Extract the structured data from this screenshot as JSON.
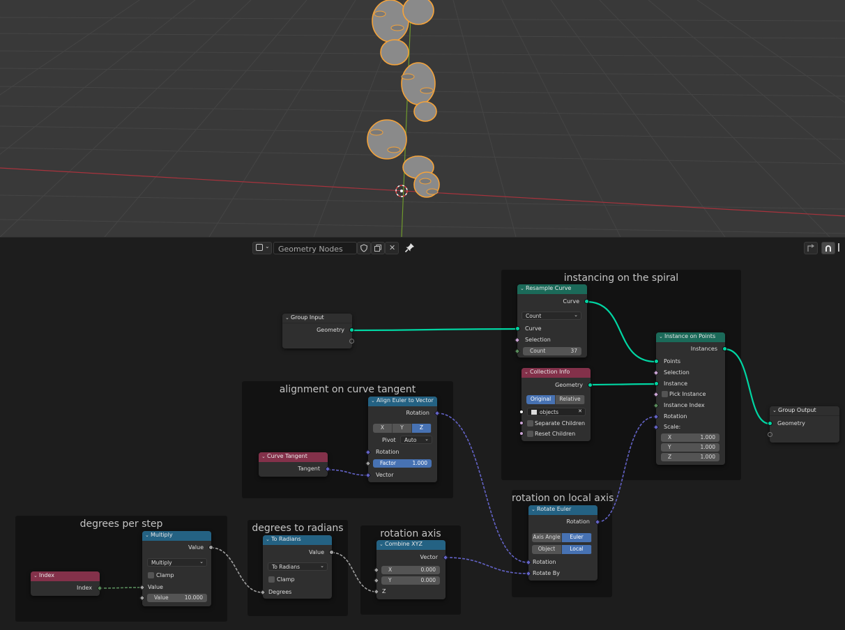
{
  "header": {
    "node_tree_name": "Geometry Nodes"
  },
  "frames": {
    "instancing": "instancing on the spiral",
    "alignment": "alignment on curve tangent",
    "degrees_per_step": "degrees per step",
    "degrees_to_radians": "degrees to radians",
    "rotation_axis": "rotation axis",
    "rotation_local": "rotation on local axis"
  },
  "nodes": {
    "group_input": {
      "title": "Group Input",
      "geometry": "Geometry"
    },
    "resample_curve": {
      "title": "Resample Curve",
      "out_curve": "Curve",
      "mode": "Count",
      "in_curve": "Curve",
      "selection": "Selection",
      "count_label": "Count",
      "count_value": "37"
    },
    "instance_on_points": {
      "title": "Instance on Points",
      "instances": "Instances",
      "points": "Points",
      "selection": "Selection",
      "instance": "Instance",
      "pick_instance": "Pick Instance",
      "instance_index": "Instance Index",
      "rotation": "Rotation",
      "scale": "Scale:",
      "x_label": "X",
      "x": "1.000",
      "y_label": "Y",
      "y": "1.000",
      "z_label": "Z",
      "z": "1.000"
    },
    "collection_info": {
      "title": "Collection Info",
      "geometry": "Geometry",
      "original": "Original",
      "relative": "Relative",
      "collection": "objects",
      "separate_children": "Separate Children",
      "reset_children": "Reset Children"
    },
    "group_output": {
      "title": "Group Output",
      "geometry": "Geometry"
    },
    "align_euler": {
      "title": "Align Euler to Vector",
      "rotation_out": "Rotation",
      "axis_x": "X",
      "axis_y": "Y",
      "axis_z": "Z",
      "pivot_label": "Pivot",
      "pivot": "Auto",
      "rotation_in": "Rotation",
      "factor_label": "Factor",
      "factor": "1.000",
      "vector": "Vector"
    },
    "curve_tangent": {
      "title": "Curve Tangent",
      "tangent": "Tangent"
    },
    "rotate_euler": {
      "title": "Rotate Euler",
      "rotation_out": "Rotation",
      "axis_angle": "Axis Angle",
      "euler": "Euler",
      "object": "Object",
      "local": "Local",
      "rotation_in": "Rotation",
      "rotate_by": "Rotate By"
    },
    "multiply": {
      "title": "Multiply",
      "value_out": "Value",
      "op": "Multiply",
      "clamp": "Clamp",
      "value_in": "Value",
      "value_label": "Value",
      "value": "10.000"
    },
    "index": {
      "title": "Index",
      "index": "Index"
    },
    "to_radians": {
      "title": "To Radians",
      "value_out": "Value",
      "op": "To Radians",
      "clamp": "Clamp",
      "degrees": "Degrees"
    },
    "combine_xyz": {
      "title": "Combine XYZ",
      "vector": "Vector",
      "x_label": "X",
      "x": "0.000",
      "y_label": "Y",
      "y": "0.000",
      "z": "Z"
    }
  },
  "colors": {
    "geometry_socket": "#00d6a3",
    "vector_socket": "#6363c7",
    "float_socket": "#a1a1a1",
    "int_socket": "#598c5c",
    "bool_socket": "#cca6d6",
    "object_orange": "#f5a33a"
  }
}
